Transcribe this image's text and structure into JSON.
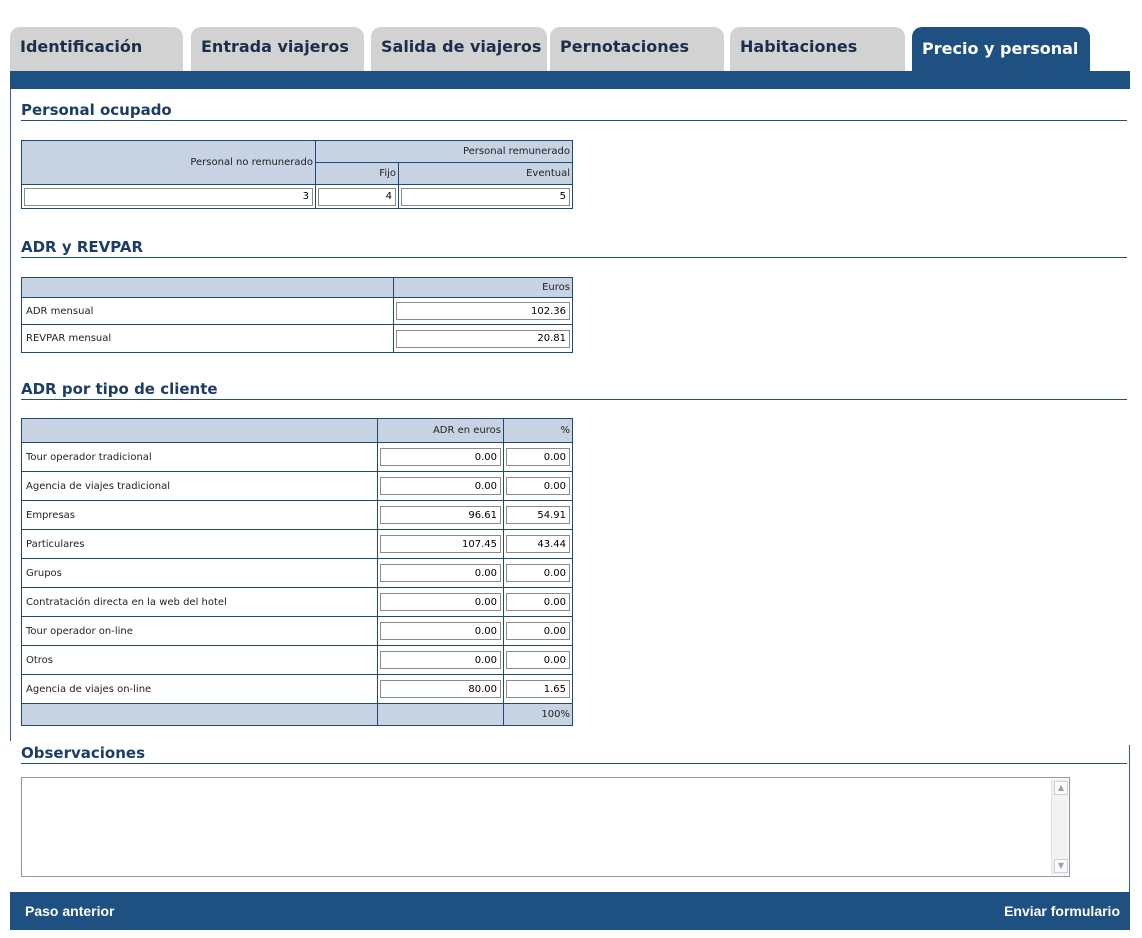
{
  "tabs": [
    {
      "label": "Identificación"
    },
    {
      "label": "Entrada viajeros"
    },
    {
      "label": "Salida de viajeros"
    },
    {
      "label": "Pernotaciones"
    },
    {
      "label": "Habitaciones"
    },
    {
      "label": "Precio y personal",
      "active": true
    }
  ],
  "personal": {
    "title": "Personal ocupado",
    "h_no_remunerado": "Personal no remunerado",
    "h_remunerado": "Personal remunerado",
    "h_fijo": "Fijo",
    "h_eventual": "Eventual",
    "no_remunerado": "3",
    "fijo": "4",
    "eventual": "5"
  },
  "adr_revpar": {
    "title": "ADR y REVPAR",
    "h_euros": "Euros",
    "adr_label": "ADR mensual",
    "adr_value": "102.36",
    "revpar_label": "REVPAR mensual",
    "revpar_value": "20.81"
  },
  "adr_cliente": {
    "title": "ADR por tipo de cliente",
    "h_adr": "ADR en euros",
    "h_pct": "%",
    "rows": [
      {
        "label": "Tour operador tradicional",
        "adr": "0.00",
        "pct": "0.00"
      },
      {
        "label": "Agencia de viajes tradicional",
        "adr": "0.00",
        "pct": "0.00"
      },
      {
        "label": "Empresas",
        "adr": "96.61",
        "pct": "54.91"
      },
      {
        "label": "Particulares",
        "adr": "107.45",
        "pct": "43.44"
      },
      {
        "label": "Grupos",
        "adr": "0.00",
        "pct": "0.00"
      },
      {
        "label": "Contratación directa en la web del hotel",
        "adr": "0.00",
        "pct": "0.00"
      },
      {
        "label": "Tour operador on-line",
        "adr": "0.00",
        "pct": "0.00"
      },
      {
        "label": "Otros",
        "adr": "0.00",
        "pct": "0.00"
      },
      {
        "label": "Agencia de viajes on-line",
        "adr": "80.00",
        "pct": "1.65"
      }
    ],
    "total_pct": "100%"
  },
  "observaciones": {
    "title": "Observaciones",
    "value": ""
  },
  "footer": {
    "prev_label": "Paso anterior",
    "next_label": "Enviar formulario"
  },
  "colors": {
    "accent": "#1e5082",
    "tab_inactive": "#d2d2d2",
    "table_header": "#c7d3e3"
  }
}
